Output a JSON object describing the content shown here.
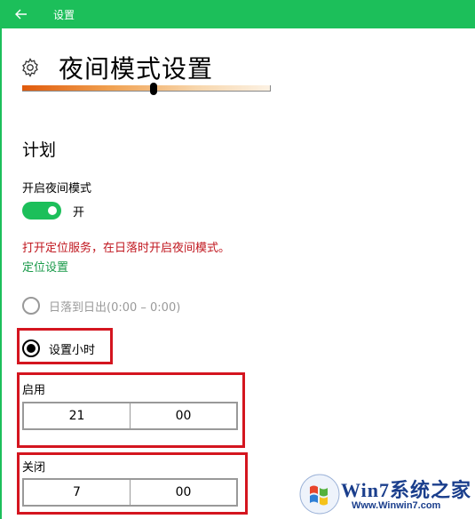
{
  "titlebar": {
    "back_icon": "arrow-left-icon",
    "title": "设置"
  },
  "header": {
    "icon": "gear-icon",
    "title": "夜间模式设置"
  },
  "slider": {
    "value_fraction": 0.53
  },
  "schedule": {
    "section_title": "计划",
    "toggle_label": "开启夜间模式",
    "toggle_state": "开",
    "toggle_on": true,
    "warning": "打开定位服务，在日落时开启夜间模式。",
    "location_link": "定位设置",
    "radio_sunset": "日落到日出(0:00 – 0:00)",
    "radio_hours": "设置小时",
    "start_label": "启用",
    "start_hour": "21",
    "start_minute": "00",
    "end_label": "关闭",
    "end_hour": "7",
    "end_minute": "00"
  },
  "watermark": {
    "brand": "Win7系统之家",
    "url": "Www.Winwin7.com"
  },
  "colors": {
    "accent": "#1cbf5a",
    "warning": "#c0161e",
    "link": "#1a9a4a",
    "highlight_box": "#d4151f"
  }
}
